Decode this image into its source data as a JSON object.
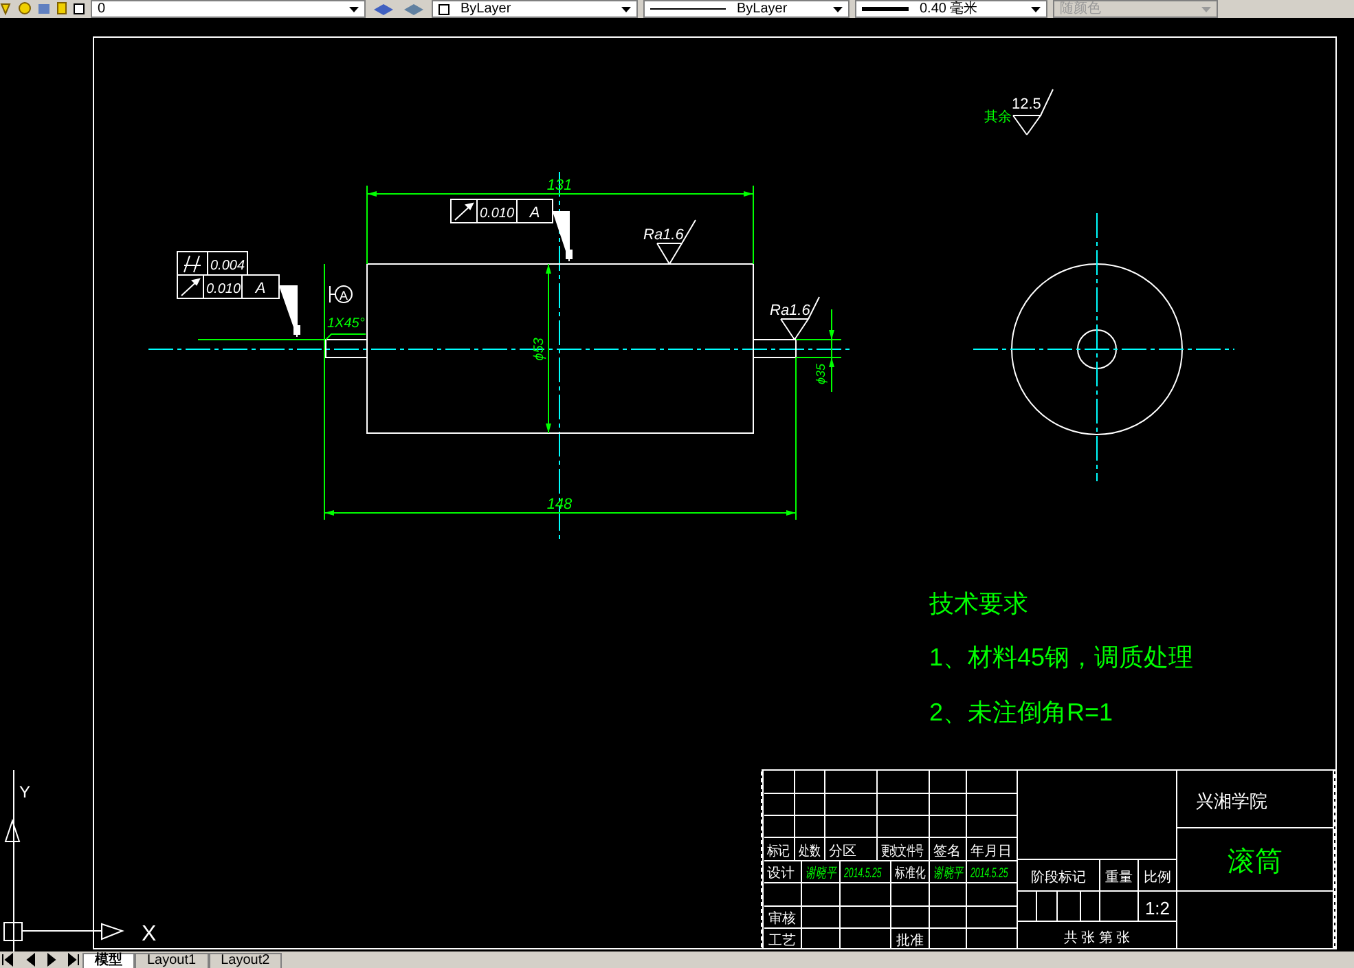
{
  "toolbar": {
    "layer": "0",
    "color_setting": "ByLayer",
    "linetype": "ByLayer",
    "lineweight": "0.40 毫米",
    "plot_style": {
      "text": "随颜色",
      "disabled": true
    }
  },
  "drawing": {
    "length_overall": "131",
    "length_total": "148",
    "body_diameter": "ϕ53",
    "shaft_diameter": "ϕ35",
    "chamfer": "1X45°",
    "datum": "A",
    "tolerance_top": {
      "value": "0.010",
      "datum": "A"
    },
    "tolerance_left": [
      {
        "value": "0.004"
      },
      {
        "value": "0.010",
        "datum": "A"
      }
    ],
    "roughness": [
      "Ra1.6",
      "Ra1.6"
    ],
    "general_finish": {
      "label": "其余",
      "value": "12.5"
    },
    "axis_labels": [
      "X",
      "Y"
    ]
  },
  "tech_requirements": {
    "title": "技术要求",
    "items": [
      "1、材料45钢，调质处理",
      "2、未注倒角R=1"
    ]
  },
  "title_block": {
    "header_labels": [
      "标记",
      "处数",
      "分区",
      "更改文件号",
      "签名",
      "年月日"
    ],
    "design_row": [
      {
        "text": "设计",
        "kind": "label"
      },
      {
        "text": "谢晓平",
        "kind": "entry"
      },
      {
        "text": "2014.5.25",
        "kind": "entry"
      },
      {
        "text": "标准化",
        "kind": "label"
      },
      {
        "text": "谢晓平",
        "kind": "entry"
      },
      {
        "text": "2014.5.25",
        "kind": "entry"
      }
    ],
    "review_label": "审核",
    "process_label": "工艺",
    "approve_label": "批准",
    "stage_labels": [
      "阶段标记",
      "重量",
      "比例"
    ],
    "scale": "1:2",
    "sheet": "共 张 第 张",
    "school": "兴湘学院",
    "part_name": "滚筒"
  },
  "tabs": [
    {
      "label": "模型",
      "selected": true
    },
    {
      "label": "Layout1",
      "selected": false
    },
    {
      "label": "Layout2",
      "selected": false
    }
  ]
}
